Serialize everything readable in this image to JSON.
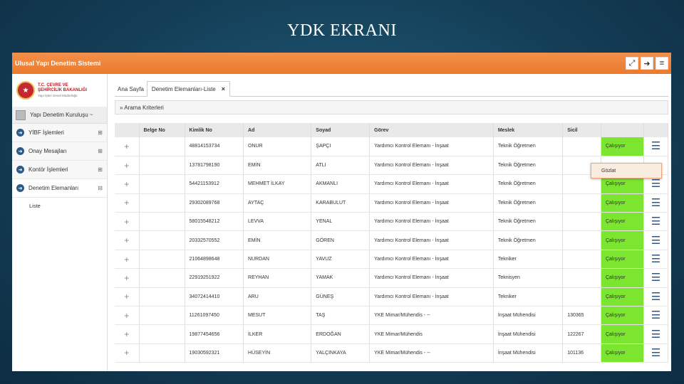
{
  "slide_title": "YDK EKRANI",
  "app": {
    "title": "Ulusal Yapı Denetim Sistemi",
    "icons": [
      "expand-icon",
      "logout-icon",
      "menu-icon"
    ]
  },
  "logo": {
    "line1": "T.C. ÇEVRE VE",
    "line2": "ŞEHİRCİLİK BAKANLIĞI",
    "line3": "Yapı İşleri Genel Müdürlüğü"
  },
  "user": {
    "label": "Yapı Denetim Kuruluşu ~"
  },
  "sidebar": {
    "items": [
      {
        "label": "YİBF İşlemleri",
        "toggle": "⊞"
      },
      {
        "label": "Onay Mesajları",
        "toggle": "⊞"
      },
      {
        "label": "Kontör İşlemleri",
        "toggle": "⊞"
      },
      {
        "label": "Denetim Elemanları",
        "toggle": "⊟"
      }
    ],
    "subitem": "Liste"
  },
  "tabs": [
    {
      "label": "Ana Sayfa"
    },
    {
      "label": "Denetim Elemanları-Liste",
      "close": "×"
    }
  ],
  "criteria_label": "» Arama Kriterleri",
  "table": {
    "headers": [
      "Belge No",
      "Kimlik No",
      "Ad",
      "Soyad",
      "Görev",
      "Meslek",
      "Sicil"
    ],
    "rows": [
      {
        "belge": "",
        "kimlik": "48814153734",
        "ad": "ONUR",
        "soyad": "ŞAPÇI",
        "gorev": "Yardımcı Kontrol Elemanı - İnşaat",
        "meslek": "Teknik Öğretmen",
        "sicil": "",
        "status": "Çalışıyor"
      },
      {
        "belge": "",
        "kimlik": "13781798190",
        "ad": "EMİN",
        "soyad": "ATLI",
        "gorev": "Yardımcı Kontrol Elemanı - İnşaat",
        "meslek": "Teknik Öğretmen",
        "sicil": "",
        "status": ""
      },
      {
        "belge": "",
        "kimlik": "54421153912",
        "ad": "MEHMET İLKAY",
        "soyad": "AKMANLI",
        "gorev": "Yardımcı Kontrol Elemanı - İnşaat",
        "meslek": "Teknik Öğretmen",
        "sicil": "",
        "status": "Çalışıyor"
      },
      {
        "belge": "",
        "kimlik": "29302089768",
        "ad": "AYTAÇ",
        "soyad": "KARABULUT",
        "gorev": "Yardımcı Kontrol Elemanı - İnşaat",
        "meslek": "Teknik Öğretmen",
        "sicil": "",
        "status": "Çalışıyor"
      },
      {
        "belge": "",
        "kimlik": "58015548212",
        "ad": "LEVVA",
        "soyad": "YENAL",
        "gorev": "Yardımcı Kontrol Elemanı - İnşaat",
        "meslek": "Teknik Öğretmen",
        "sicil": "",
        "status": "Çalışıyor"
      },
      {
        "belge": "",
        "kimlik": "20332570552",
        "ad": "EMİN",
        "soyad": "GÖREN",
        "gorev": "Yardımcı Kontrol Elemanı - İnşaat",
        "meslek": "Teknik Öğretmen",
        "sicil": "",
        "status": "Çalışıyor"
      },
      {
        "belge": "",
        "kimlik": "21064898648",
        "ad": "NURDAN",
        "soyad": "YAVUZ",
        "gorev": "Yardımcı Kontrol Elemanı - İnşaat",
        "meslek": "Tekniker",
        "sicil": "",
        "status": "Çalışıyor"
      },
      {
        "belge": "",
        "kimlik": "22919251922",
        "ad": "REYHAN",
        "soyad": "YAMAK",
        "gorev": "Yardımcı Kontrol Elemanı - İnşaat",
        "meslek": "Teknisyen",
        "sicil": "",
        "status": "Çalışıyor"
      },
      {
        "belge": "",
        "kimlik": "34072414410",
        "ad": "ARU",
        "soyad": "GÜNEŞ",
        "gorev": "Yardımcı Kontrol Elemanı - İnşaat",
        "meslek": "Tekniker",
        "sicil": "",
        "status": "Çalışıyor"
      },
      {
        "belge": "",
        "kimlik": "11261097450",
        "ad": "MESUT",
        "soyad": "TAŞ",
        "gorev": "YKE Mimar/Mühendis - --",
        "meslek": "İnşaat Mühendisi",
        "sicil": "130365",
        "status": "Çalışıyor"
      },
      {
        "belge": "",
        "kimlik": "19877454656",
        "ad": "İLKER",
        "soyad": "ERDOĞAN",
        "gorev": "YKE Mimar/Mühendis",
        "meslek": "İnşaat Mühendisi",
        "sicil": "122267",
        "status": "Çalışıyor"
      },
      {
        "belge": "",
        "kimlik": "19030592321",
        "ad": "HÜSEYİN",
        "soyad": "YALÇINKAYA",
        "gorev": "YKE Mimar/Mühendis - --",
        "meslek": "İnşaat Mühendisi",
        "sicil": "101136",
        "status": "Çalışıyor"
      }
    ]
  },
  "popup": {
    "label": "Gözlat"
  },
  "colors": {
    "topbar": "#ea7a2f",
    "status_green": "#7be52f",
    "accent_blue": "#2e5586"
  }
}
